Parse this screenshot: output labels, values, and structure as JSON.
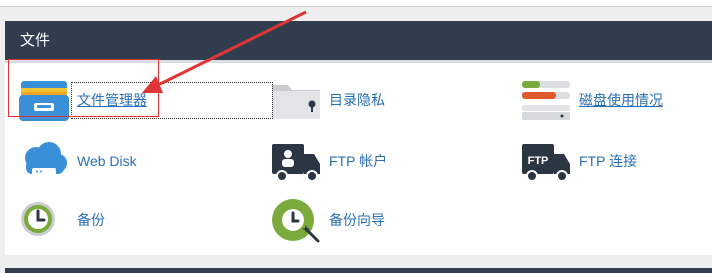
{
  "section": {
    "title": "文件"
  },
  "items": [
    {
      "label": "文件管理器",
      "icon": "file-manager-icon",
      "underlined": true
    },
    {
      "label": "目录隐私",
      "icon": "directory-privacy-icon"
    },
    {
      "label": "磁盘使用情况",
      "icon": "disk-usage-icon",
      "underlined": true
    },
    {
      "label": "Web Disk",
      "icon": "web-disk-icon"
    },
    {
      "label": "FTP 帐户",
      "icon": "ftp-accounts-icon"
    },
    {
      "label": "FTP 连接",
      "icon": "ftp-connections-icon"
    },
    {
      "label": "备份",
      "icon": "backup-icon"
    },
    {
      "label": "备份向导",
      "icon": "backup-wizard-icon"
    }
  ],
  "icon_text": {
    "ftp": "FTP"
  },
  "colors": {
    "header_bg": "#2f3d4f",
    "link": "#2a6fb5",
    "annotation_red": "#e03535",
    "green": "#7aaa3c",
    "blue": "#3a8fd9",
    "dark": "#2c3542"
  }
}
